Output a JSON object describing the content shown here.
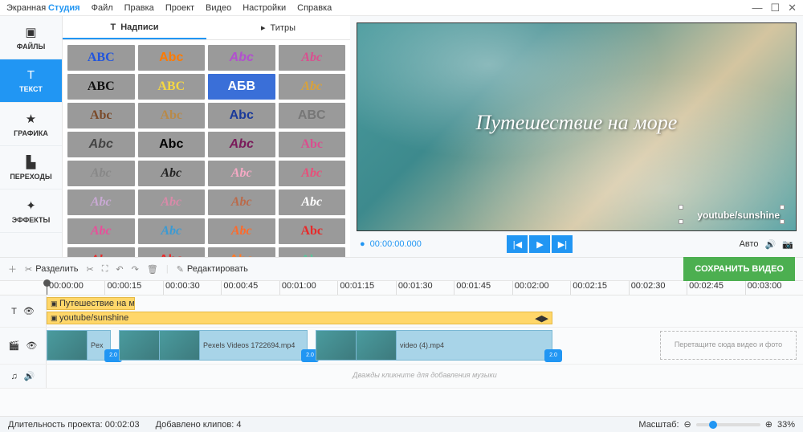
{
  "brand": {
    "part1": "Экранная",
    "part2": "Студия"
  },
  "menu": [
    "Файл",
    "Правка",
    "Проект",
    "Видео",
    "Настройки",
    "Справка"
  ],
  "sidebar": [
    {
      "icon": "image-icon",
      "label": "ФАЙЛЫ"
    },
    {
      "icon": "text-icon",
      "label": "ТЕКСТ"
    },
    {
      "icon": "star-icon",
      "label": "ГРАФИКА"
    },
    {
      "icon": "layers-icon",
      "label": "ПЕРЕХОДЫ"
    },
    {
      "icon": "sparkle-icon",
      "label": "ЭФФЕКТЫ"
    }
  ],
  "tabs": {
    "captions": "Надписи",
    "titles": "Титры"
  },
  "swatches": [
    {
      "text": "ABC",
      "color": "#2255dd",
      "ff": "Arial Black",
      "fs": "normal",
      "bg": "#9a9a9a"
    },
    {
      "text": "Abc",
      "color": "#ff7a00",
      "ff": "Arial",
      "fs": "normal",
      "bg": "#9a9a9a"
    },
    {
      "text": "Abc",
      "color": "#b24fcf",
      "ff": "Arial",
      "fs": "italic",
      "bg": "#9a9a9a"
    },
    {
      "text": "Abc",
      "color": "#d94f8f",
      "ff": "cursive",
      "fs": "italic",
      "bg": "#9a9a9a"
    },
    {
      "text": "ABC",
      "color": "#111",
      "ff": "Impact",
      "fs": "normal",
      "bg": "#9a9a9a"
    },
    {
      "text": "ABC",
      "color": "#f5d742",
      "ff": "Arial Black",
      "fs": "normal",
      "bg": "#9a9a9a"
    },
    {
      "text": "AБВ",
      "color": "#fff",
      "ff": "Arial",
      "fs": "normal",
      "bg": "#3a6fd8"
    },
    {
      "text": "Abc",
      "color": "#d9a23a",
      "ff": "serif",
      "fs": "italic",
      "bg": "#9a9a9a"
    },
    {
      "text": "Abc",
      "color": "#7a4a2a",
      "ff": "serif",
      "fs": "normal",
      "bg": "#9a9a9a"
    },
    {
      "text": "Abc",
      "color": "#b88a4a",
      "ff": "serif",
      "fs": "normal",
      "bg": "#9a9a9a"
    },
    {
      "text": "Abc",
      "color": "#1a3a9a",
      "ff": "Arial",
      "fs": "normal",
      "bg": "#9a9a9a"
    },
    {
      "text": "ABC",
      "color": "#777",
      "ff": "Arial",
      "fs": "normal",
      "bg": "#9a9a9a"
    },
    {
      "text": "Abc",
      "color": "#444",
      "ff": "Arial",
      "fs": "italic",
      "bg": "#9a9a9a"
    },
    {
      "text": "Abc",
      "color": "#000",
      "ff": "Arial",
      "fs": "normal",
      "bg": "#9a9a9a"
    },
    {
      "text": "Abc",
      "color": "#7a1a5a",
      "ff": "Arial",
      "fs": "italic",
      "bg": "#9a9a9a"
    },
    {
      "text": "Abc",
      "color": "#d94f8f",
      "ff": "Impact",
      "fs": "normal",
      "bg": "#9a9a9a"
    },
    {
      "text": "Abc",
      "color": "#888",
      "ff": "cursive",
      "fs": "italic",
      "bg": "#9a9a9a"
    },
    {
      "text": "Abc",
      "color": "#222",
      "ff": "cursive",
      "fs": "italic",
      "bg": "#9a9a9a"
    },
    {
      "text": "Abc",
      "color": "#f5a9c4",
      "ff": "cursive",
      "fs": "italic",
      "bg": "#9a9a9a"
    },
    {
      "text": "Abc",
      "color": "#e84f7a",
      "ff": "cursive",
      "fs": "italic",
      "bg": "#9a9a9a"
    },
    {
      "text": "Abc",
      "color": "#c9a9d4",
      "ff": "cursive",
      "fs": "italic",
      "bg": "#9a9a9a"
    },
    {
      "text": "Abc",
      "color": "#d98aa9",
      "ff": "cursive",
      "fs": "italic",
      "bg": "#9a9a9a"
    },
    {
      "text": "Abc",
      "color": "#bb6a4a",
      "ff": "cursive",
      "fs": "italic",
      "bg": "#9a9a9a"
    },
    {
      "text": "Abc",
      "color": "#fff",
      "ff": "cursive",
      "fs": "italic",
      "bg": "#9a9a9a"
    },
    {
      "text": "Abc",
      "color": "#e84f9a",
      "ff": "cursive",
      "fs": "italic",
      "bg": "#9a9a9a"
    },
    {
      "text": "Abc",
      "color": "#3a9ad4",
      "ff": "cursive",
      "fs": "italic",
      "bg": "#9a9a9a"
    },
    {
      "text": "Abc",
      "color": "#ff6a2a",
      "ff": "cursive",
      "fs": "italic",
      "bg": "#9a9a9a"
    },
    {
      "text": "Abc",
      "color": "#e82a2a",
      "ff": "Arial Black",
      "fs": "normal",
      "bg": "#9a9a9a"
    },
    {
      "text": "Abc",
      "color": "#e82a2a",
      "ff": "Impact",
      "fs": "italic",
      "bg": "#9a9a9a"
    },
    {
      "text": "Abc",
      "color": "#e82a2a",
      "ff": "Arial",
      "fs": "normal",
      "bg": "#9a9a9a"
    },
    {
      "text": "Abc",
      "color": "#ff7a2a",
      "ff": "Arial",
      "fs": "normal",
      "bg": "#9a9a9a"
    },
    {
      "text": "Abc",
      "color": "#5ac49a",
      "ff": "cursive",
      "fs": "normal",
      "bg": "#9a9a9a"
    }
  ],
  "preview": {
    "overlay_text": "Путешествие на море",
    "watermark": "youtube/sunshine",
    "timecode": "00:00:00.000",
    "auto": "Авто"
  },
  "toolbar": {
    "split": "Разделить",
    "edit": "Редактировать",
    "save": "СОХРАНИТЬ ВИДЕО"
  },
  "ruler": [
    "00:00:00",
    "00:00:15",
    "00:00:30",
    "00:00:45",
    "00:01:00",
    "00:01:15",
    "00:01:30",
    "00:01:45",
    "00:02:00",
    "00:02:15",
    "00:02:30",
    "00:02:45",
    "00:03:00"
  ],
  "tracks": {
    "text1": "Путешествие на мор",
    "text2": "youtube/sunshine",
    "video1_label": "Pex",
    "video2_label": "Pexels Videos 1722694.mp4",
    "video3_label": "video (4).mp4",
    "trans_dur": "2.0",
    "drop_hint": "Перетащите сюда видео и фото",
    "music_hint": "Дважды кликните для добавления музыки"
  },
  "status": {
    "duration_label": "Длительность проекта:",
    "duration": "00:02:03",
    "clips_label": "Добавлено клипов:",
    "clips": "4",
    "zoom_label": "Масштаб:",
    "zoom_pct": "33%"
  }
}
